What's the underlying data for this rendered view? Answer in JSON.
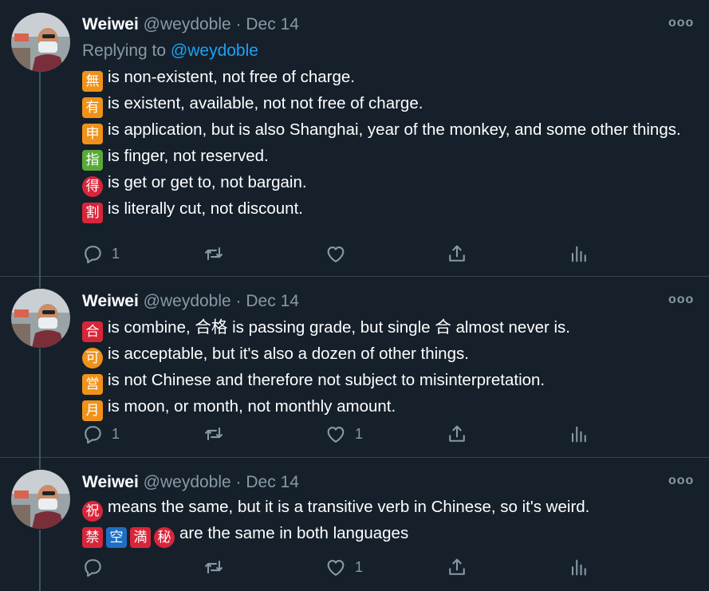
{
  "colors": {
    "background": "#15202b",
    "text": "#ffffff",
    "muted": "#8899a6",
    "link": "#1da1f2",
    "emoji_orange": "#f0921a",
    "emoji_green": "#59a93a",
    "emoji_red": "#d8253a",
    "emoji_blue": "#1e6fc3"
  },
  "tweets": [
    {
      "author_name": "Weiwei",
      "handle": "@weydoble",
      "separator": "·",
      "date": "Dec 14",
      "more_icon": "more-horizontal-icon",
      "replying_prefix": "Replying to",
      "replying_to": "@weydoble",
      "lines": [
        {
          "glyph": "無",
          "text": "is non-existent, not free of charge."
        },
        {
          "glyph": "有",
          "text": "is existent, available, not not free of charge."
        },
        {
          "glyph": "申",
          "text": "is application, but is also Shanghai, year of the monkey, and some other things."
        },
        {
          "glyph": "指",
          "text": "is finger, not reserved."
        },
        {
          "glyph": "得",
          "text": "is get or get to, not bargain."
        },
        {
          "glyph": "割",
          "text": "is literally cut, not discount."
        }
      ],
      "actions": {
        "reply_count": "1",
        "retweet_count": "",
        "like_count": "",
        "icons": [
          "reply-icon",
          "retweet-icon",
          "like-icon",
          "share-icon",
          "analytics-icon"
        ]
      }
    },
    {
      "author_name": "Weiwei",
      "handle": "@weydoble",
      "separator": "·",
      "date": "Dec 14",
      "more_icon": "more-horizontal-icon",
      "lines": [
        {
          "glyph": "合",
          "text_a": "is combine,",
          "inline_text": "合格",
          "text_b": "is passing grade, but single",
          "inline_glyph": "合",
          "text_c": "almost never is."
        },
        {
          "glyph": "可",
          "text": "is acceptable, but it's also a dozen of other things."
        },
        {
          "glyph": "営",
          "text": "is not Chinese and therefore not subject to misinterpretation."
        },
        {
          "glyph": "月",
          "text": "is moon, or month, not monthly amount."
        }
      ],
      "actions": {
        "reply_count": "1",
        "retweet_count": "",
        "like_count": "1"
      }
    },
    {
      "author_name": "Weiwei",
      "handle": "@weydoble",
      "separator": "·",
      "date": "Dec 14",
      "more_icon": "more-horizontal-icon",
      "lines": [
        {
          "glyph": "祝",
          "text": "means the same, but it is a transitive verb in Chinese, so it's weird."
        },
        {
          "glyphs": [
            "禁",
            "空",
            "満",
            "秘"
          ],
          "text": "are the same in both languages"
        }
      ],
      "actions": {
        "reply_count": "",
        "retweet_count": "",
        "like_count": "1"
      }
    }
  ]
}
